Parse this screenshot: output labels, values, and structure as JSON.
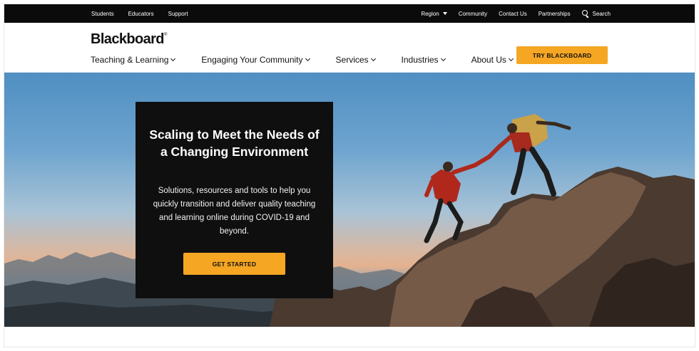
{
  "utility_bar": {
    "left_links": [
      "Students",
      "Educators",
      "Support"
    ],
    "region_label": "Region",
    "right_links": [
      "Community",
      "Contact Us",
      "Partnerships"
    ],
    "search_label": "Search",
    "search_icon": "search-icon"
  },
  "header": {
    "logo": "Blackboard",
    "logo_mark": "®",
    "nav": [
      "Teaching & Learning",
      "Engaging Your Community",
      "Services",
      "Industries",
      "About Us"
    ],
    "cta_label": "TRY BLACKBOARD"
  },
  "hero": {
    "title": "Scaling to Meet the Needs of a Changing Environment",
    "subtitle": "Solutions, resources and tools to help you quickly transition and deliver quality teaching and learning online during COVID-19 and beyond.",
    "button_label": "GET STARTED",
    "image_description_icon": "climbers-photo"
  },
  "colors": {
    "accent": "#f5a623",
    "utility_bar": "#0b0b0b",
    "card": "#0f0f0f"
  }
}
